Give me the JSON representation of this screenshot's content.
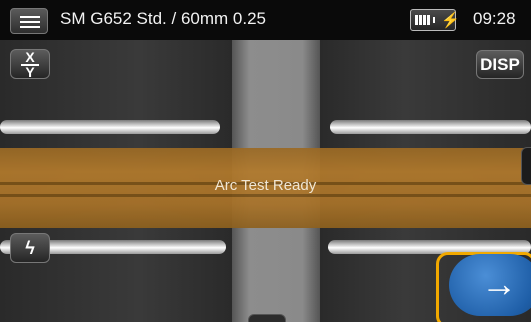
{
  "status_bar": {
    "menu_icon": "hamburger-menu-icon",
    "title": "SM G652 Std. / 60mm 0.25",
    "battery_icon": "battery-charging-icon",
    "time": "09:28"
  },
  "camera_view": {
    "status_message": "Arc Test Ready",
    "band_color": "#b27a2c"
  },
  "buttons": {
    "xy_top": "X",
    "xy_bottom": "Y",
    "disp": "DISP",
    "arc_icon": "lightning-bolt-icon",
    "next_icon": "right-arrow-icon"
  },
  "colors": {
    "highlight": "#f2a900",
    "next_button": "#2a6fc0"
  }
}
